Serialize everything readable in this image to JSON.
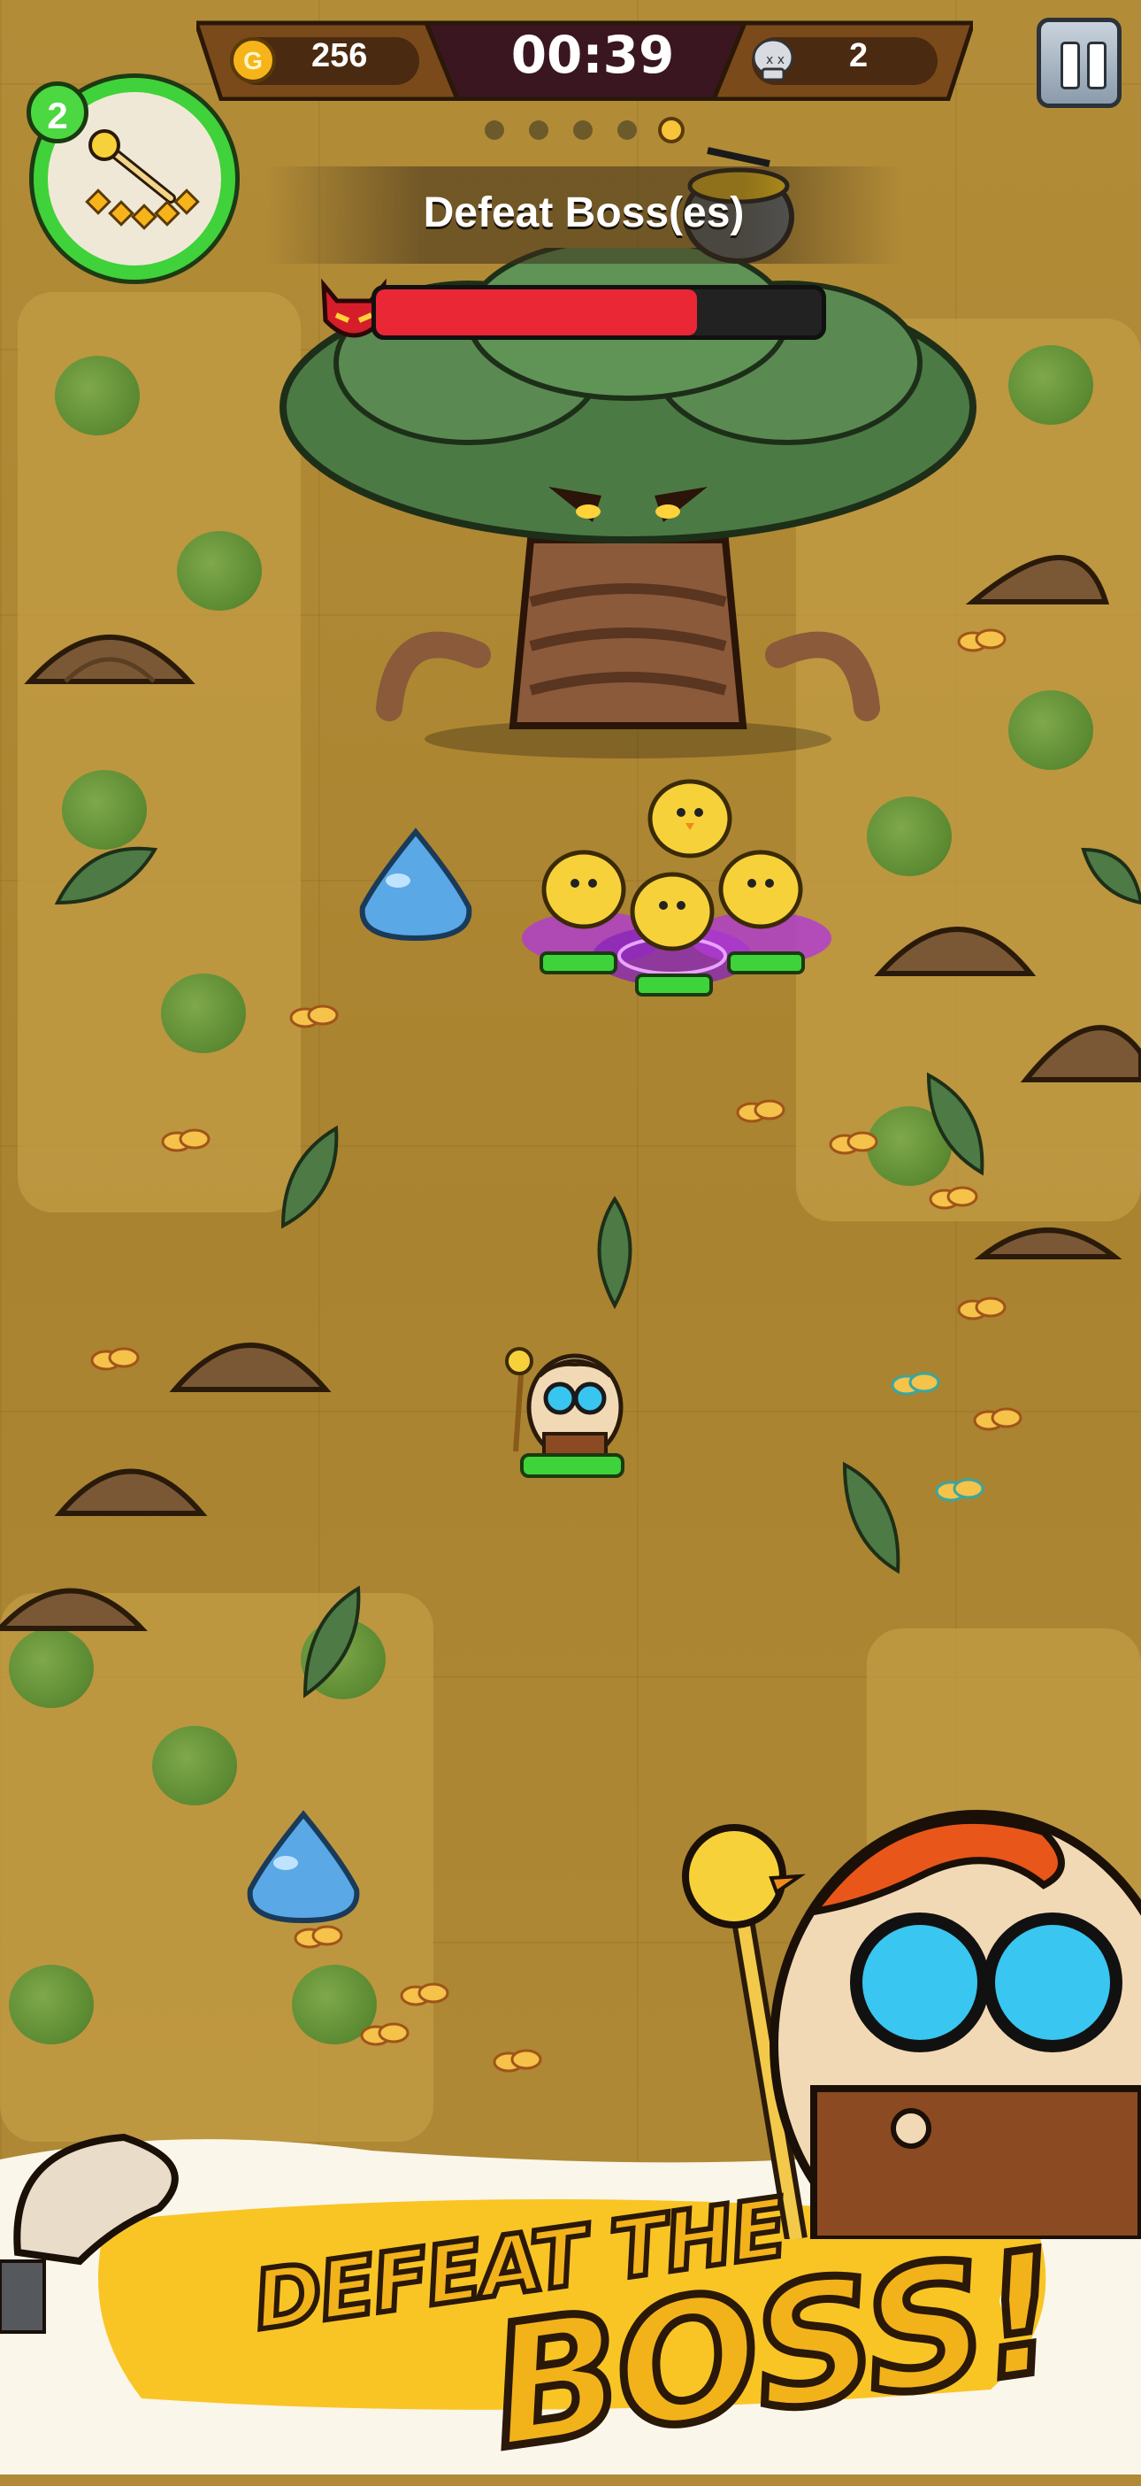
{
  "hud": {
    "gold": "256",
    "timer": "00:39",
    "kills": "2",
    "level": "2",
    "wave_total": 5,
    "wave_current": 5
  },
  "objective": {
    "text": "Defeat Boss(es)"
  },
  "boss": {
    "health_fraction": 0.72
  },
  "banner": {
    "line1": "DEFEAT THE",
    "line2": "BOSS!"
  },
  "icons": {
    "gold": "gold-coin-icon",
    "kills": "skull-icon",
    "pause": "pause-icon",
    "boss": "demon-face-icon",
    "weapon": "chick-staff-icon"
  },
  "colors": {
    "level_ring": "#3fd23a",
    "boss_health": "#ea2734",
    "gold": "#f2b21a"
  }
}
